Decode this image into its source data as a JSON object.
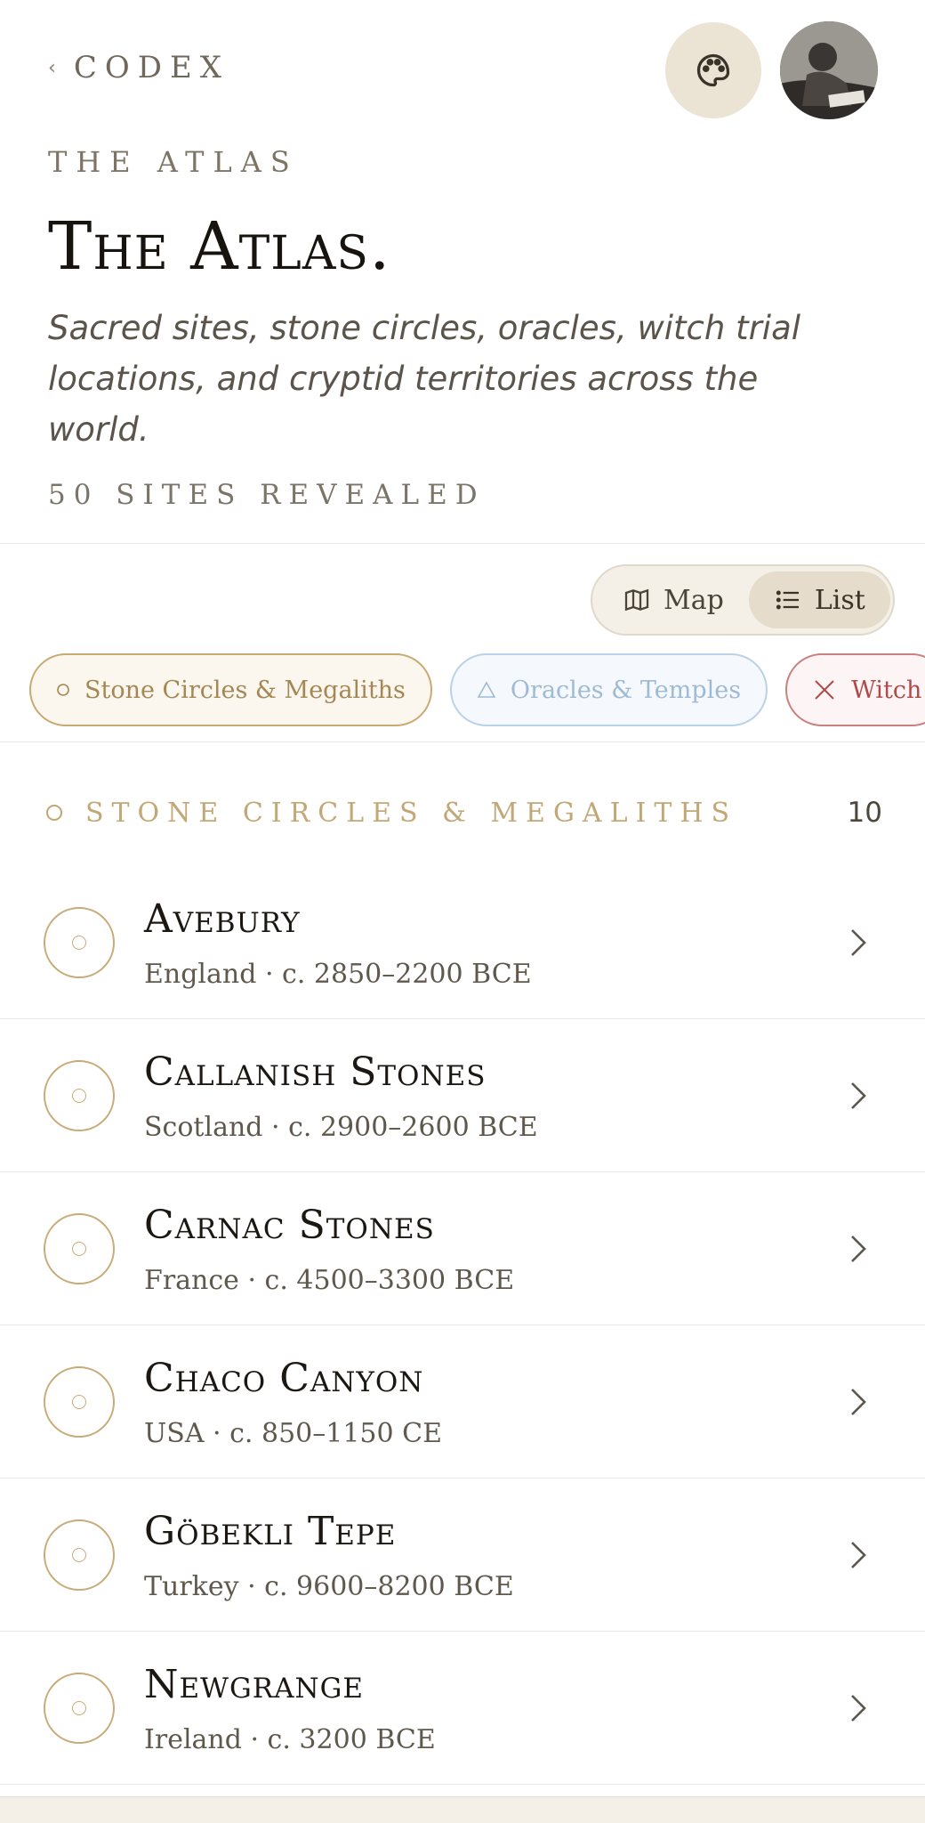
{
  "nav": {
    "back_label": "CODEX"
  },
  "header": {
    "eyebrow": "THE ATLAS",
    "title": "The Atlas.",
    "subtitle": "Sacred sites, stone circles, oracles, witch trial locations, and cryptid territories across the world.",
    "sites_count": "50 SITES REVEALED"
  },
  "view_toggle": {
    "map_label": "Map",
    "list_label": "List",
    "active": "List"
  },
  "filters": [
    {
      "label": "Stone Circles & Megaliths",
      "icon": "circle-icon"
    },
    {
      "label": "Oracles & Temples",
      "icon": "triangle-icon"
    },
    {
      "label": "Witch",
      "icon": "x-icon"
    }
  ],
  "section": {
    "label": "STONE CIRCLES & MEGALITHS",
    "count": "10"
  },
  "sites": [
    {
      "name": "Avebury",
      "meta": "England · c. 2850–2200 BCE"
    },
    {
      "name": "Callanish Stones",
      "meta": "Scotland · c. 2900–2600 BCE"
    },
    {
      "name": "Carnac Stones",
      "meta": "France · c. 4500–3300 BCE"
    },
    {
      "name": "Chaco Canyon",
      "meta": "USA · c. 850–1150 CE"
    },
    {
      "name": "Göbekli Tepe",
      "meta": "Turkey · c. 9600–8200 BCE"
    },
    {
      "name": "Newgrange",
      "meta": "Ireland · c. 3200 BCE"
    }
  ],
  "colors": {
    "accent_gold": "#c8ab78",
    "oracle_blue": "#b9d2ea",
    "witch_red": "#b04a4a",
    "toggle_active_bg": "#e5dccb"
  }
}
